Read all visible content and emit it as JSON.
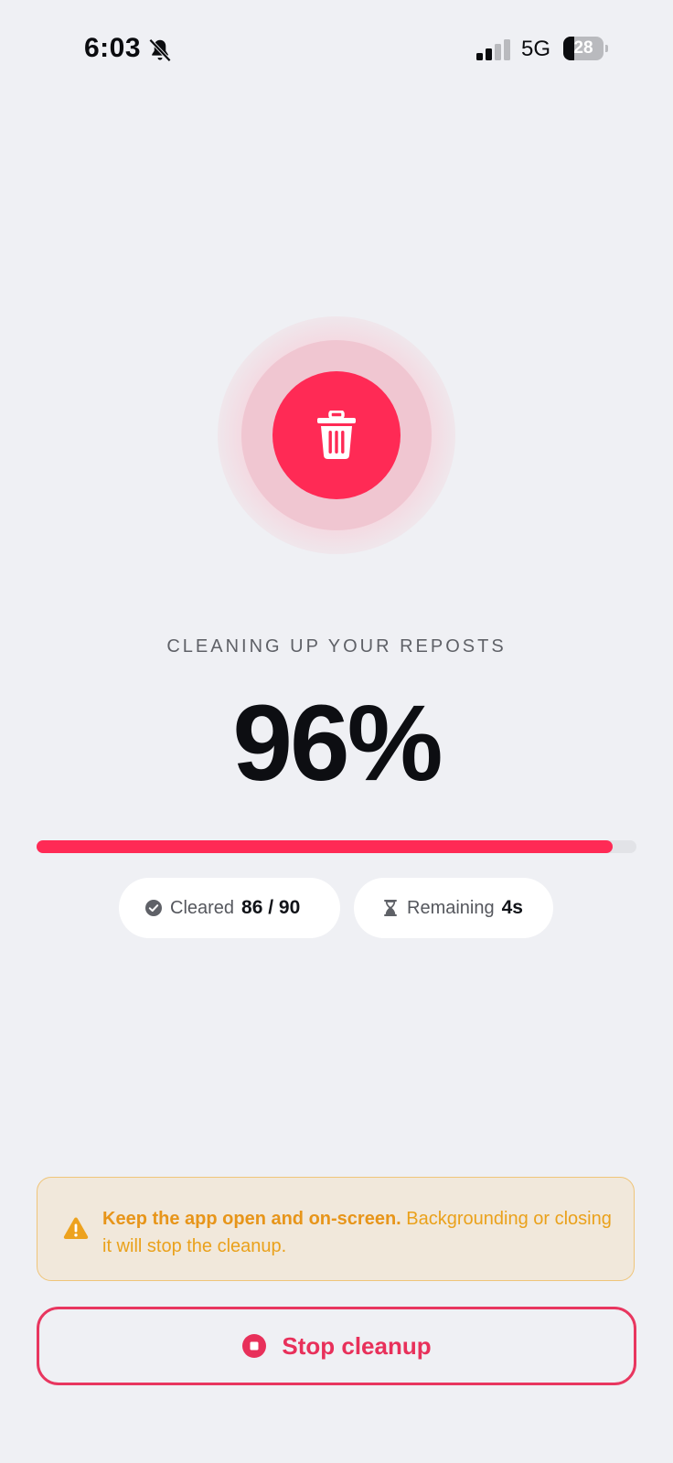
{
  "status_bar": {
    "time": "6:03",
    "network": "5G",
    "battery_level": "28",
    "battery_fraction": 0.28,
    "signal_bars_active": 2,
    "signal_bars_total": 4
  },
  "colors": {
    "accent": "#ff2a55",
    "warning": "#eaa11b",
    "background": "#eff0f4"
  },
  "hero": {
    "icon": "trash-icon"
  },
  "progress": {
    "label": "CLEANING UP YOUR REPOSTS",
    "percent_text": "96%",
    "fraction": 0.96
  },
  "stats": {
    "cleared_label": "Cleared",
    "cleared_value": "86 / 90",
    "remaining_label": "Remaining",
    "remaining_value": "4s"
  },
  "warning": {
    "icon": "warning-triangle-icon",
    "strong": "Keep the app open and on-screen.",
    "text": " Backgrounding or closing it will stop the cleanup."
  },
  "stop_button": {
    "label": "Stop cleanup",
    "icon": "stop-circle-icon"
  }
}
